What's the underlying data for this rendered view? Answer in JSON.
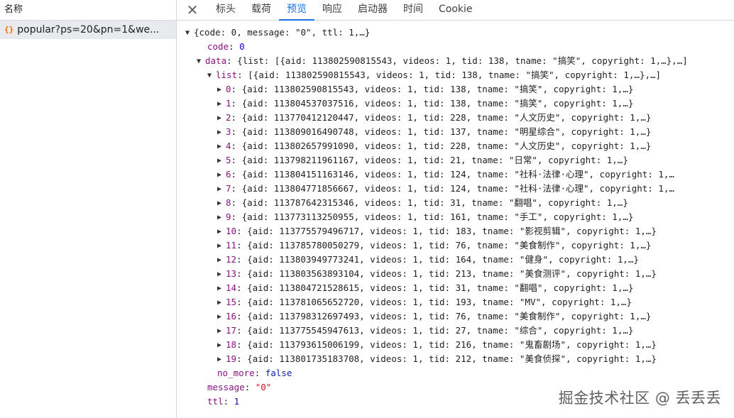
{
  "sidebar": {
    "header": "名称",
    "request": {
      "icon": "{}",
      "name": "popular?ps=20&pn=1&we..."
    }
  },
  "tabs": [
    {
      "label": "标头",
      "active": false
    },
    {
      "label": "载荷",
      "active": false
    },
    {
      "label": "预览",
      "active": true
    },
    {
      "label": "响应",
      "active": false
    },
    {
      "label": "启动器",
      "active": false
    },
    {
      "label": "时间",
      "active": false
    },
    {
      "label": "Cookie",
      "active": false
    }
  ],
  "preview": {
    "root_summary": "{code: 0, message: \"0\", ttl: 1,…}",
    "code": {
      "key": "code",
      "value": "0"
    },
    "data": {
      "key": "data",
      "summary": "{list: [{aid: 113802590815543, videos: 1, tid: 138, tname: \"搞笑\", copyright: 1,…},…]"
    },
    "list": {
      "key": "list",
      "summary": "[{aid: 113802590815543, videos: 1, tid: 138, tname: \"搞笑\", copyright: 1,…},…]"
    },
    "items": [
      {
        "index": "0",
        "text": "{aid: 113802590815543, videos: 1, tid: 138, tname: \"搞笑\", copyright: 1,…}"
      },
      {
        "index": "1",
        "text": "{aid: 113804537037516, videos: 1, tid: 138, tname: \"搞笑\", copyright: 1,…}"
      },
      {
        "index": "2",
        "text": "{aid: 113770412120447, videos: 1, tid: 228, tname: \"人文历史\", copyright: 1,…}"
      },
      {
        "index": "3",
        "text": "{aid: 113809016490748, videos: 1, tid: 137, tname: \"明星综合\", copyright: 1,…}"
      },
      {
        "index": "4",
        "text": "{aid: 113802657991090, videos: 1, tid: 228, tname: \"人文历史\", copyright: 1,…}"
      },
      {
        "index": "5",
        "text": "{aid: 113798211961167, videos: 1, tid: 21, tname: \"日常\", copyright: 1,…}"
      },
      {
        "index": "6",
        "text": "{aid: 113804151163146, videos: 1, tid: 124, tname: \"社科·法律·心理\", copyright: 1,…"
      },
      {
        "index": "7",
        "text": "{aid: 113804771856667, videos: 1, tid: 124, tname: \"社科·法律·心理\", copyright: 1,…"
      },
      {
        "index": "8",
        "text": "{aid: 113787642315346, videos: 1, tid: 31, tname: \"翻唱\", copyright: 1,…}"
      },
      {
        "index": "9",
        "text": "{aid: 113773113250955, videos: 1, tid: 161, tname: \"手工\", copyright: 1,…}"
      },
      {
        "index": "10",
        "text": "{aid: 113775579496717, videos: 1, tid: 183, tname: \"影视剪辑\", copyright: 1,…}"
      },
      {
        "index": "11",
        "text": "{aid: 113785780050279, videos: 1, tid: 76, tname: \"美食制作\", copyright: 1,…}"
      },
      {
        "index": "12",
        "text": "{aid: 113803949773241, videos: 1, tid: 164, tname: \"健身\", copyright: 1,…}"
      },
      {
        "index": "13",
        "text": "{aid: 113803563893104, videos: 1, tid: 213, tname: \"美食测评\", copyright: 1,…}"
      },
      {
        "index": "14",
        "text": "{aid: 113804721528615, videos: 1, tid: 31, tname: \"翻唱\", copyright: 1,…}"
      },
      {
        "index": "15",
        "text": "{aid: 113781065652720, videos: 1, tid: 193, tname: \"MV\", copyright: 1,…}"
      },
      {
        "index": "16",
        "text": "{aid: 113798312697493, videos: 1, tid: 76, tname: \"美食制作\", copyright: 1,…}"
      },
      {
        "index": "17",
        "text": "{aid: 113775545947613, videos: 1, tid: 27, tname: \"综合\", copyright: 1,…}"
      },
      {
        "index": "18",
        "text": "{aid: 113793615006199, videos: 1, tid: 216, tname: \"鬼畜剧场\", copyright: 1,…}"
      },
      {
        "index": "19",
        "text": "{aid: 113801735183708, videos: 1, tid: 212, tname: \"美食侦探\", copyright: 1,…}"
      }
    ],
    "no_more": {
      "key": "no_more",
      "value": "false"
    },
    "message": {
      "key": "message",
      "value": "\"0\""
    },
    "ttl": {
      "key": "ttl",
      "value": "1"
    }
  },
  "watermark": "掘金技术社区 @ 丢丢丢"
}
